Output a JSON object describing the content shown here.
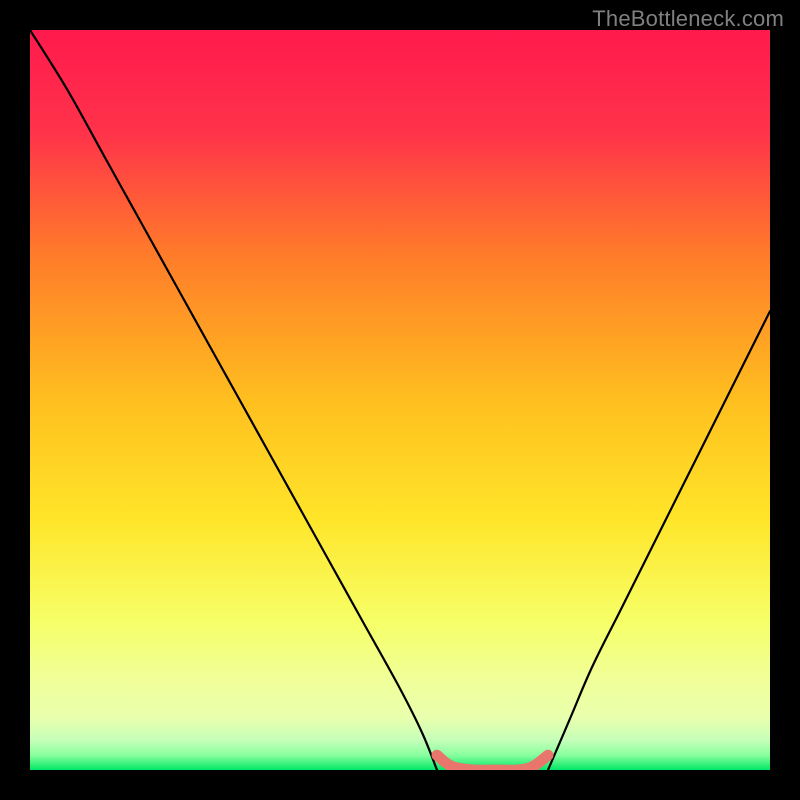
{
  "watermark": "TheBottleneck.com",
  "chart_data": {
    "type": "line",
    "title": "",
    "xlabel": "",
    "ylabel": "",
    "xlim": [
      0,
      100
    ],
    "ylim": [
      0,
      100
    ],
    "grid": false,
    "legend": false,
    "background_gradient_top_to_bottom": [
      "#ff1a4d",
      "#ff7a2a",
      "#ffe529",
      "#f6ff68",
      "#e8ffad",
      "#00e865"
    ],
    "series": [
      {
        "name": "left-curve",
        "color": "#000000",
        "x": [
          0,
          5,
          10,
          15,
          20,
          25,
          30,
          35,
          40,
          45,
          50,
          53,
          55
        ],
        "y": [
          100,
          92,
          83,
          74,
          65,
          56,
          47,
          38,
          29,
          20,
          11,
          5,
          0
        ]
      },
      {
        "name": "right-curve",
        "color": "#000000",
        "x": [
          70,
          73,
          76,
          80,
          84,
          88,
          92,
          96,
          100
        ],
        "y": [
          0,
          7,
          14,
          22,
          30,
          38,
          46,
          54,
          62
        ]
      },
      {
        "name": "bottom-highlight",
        "color": "#e9766c",
        "stroke_width": 10,
        "x": [
          55,
          57,
          60,
          63,
          66,
          68,
          70
        ],
        "y": [
          2,
          0.5,
          0,
          0,
          0,
          0.5,
          2
        ]
      }
    ]
  }
}
